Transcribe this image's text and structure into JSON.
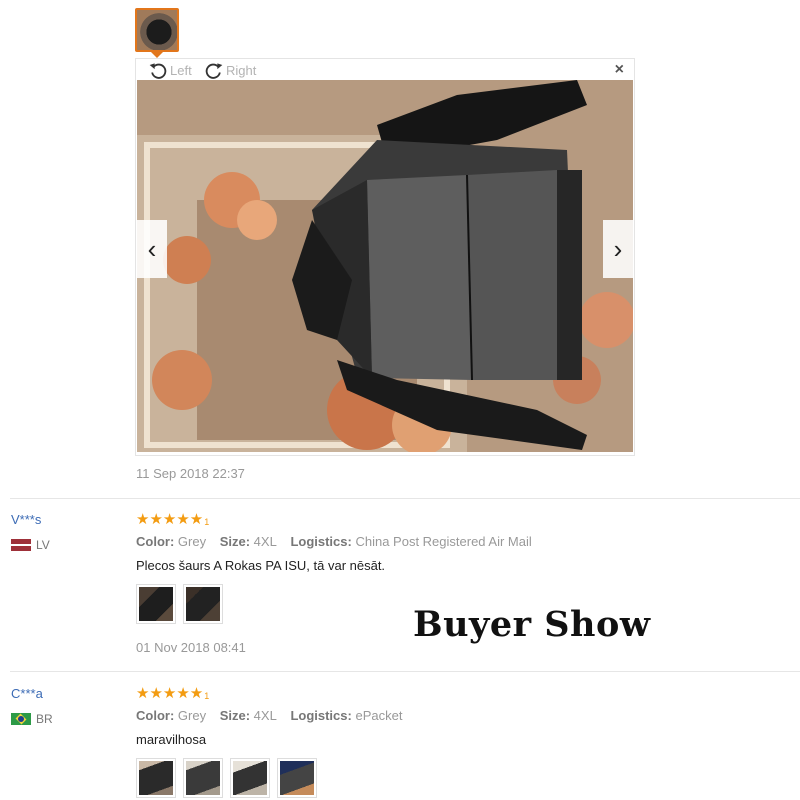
{
  "viewer": {
    "rotate_left_label": "Left",
    "rotate_right_label": "Right",
    "close_glyph": "×",
    "prev_glyph": "‹",
    "next_glyph": "›",
    "photo_date": "11 Sep 2018 22:37"
  },
  "reviews": [
    {
      "user": "V***s",
      "country": "LV",
      "stars": "★★★★★",
      "star_tail": "1",
      "color_label": "Color:",
      "color": "Grey",
      "size_label": "Size:",
      "size": "4XL",
      "logistics_label": "Logistics:",
      "logistics": "China Post Registered Air Mail",
      "comment": "Plecos šaurs A Rokas PA ISU, tā var nēsāt.",
      "date": "01 Nov 2018 08:41"
    },
    {
      "user": "C***a",
      "country": "BR",
      "stars": "★★★★★",
      "star_tail": "1",
      "color_label": "Color:",
      "color": "Grey",
      "size_label": "Size:",
      "size": "4XL",
      "logistics_label": "Logistics:",
      "logistics": "ePacket",
      "comment": "maravilhosa"
    }
  ],
  "watermark": "Buyer Show",
  "icons": {
    "rotate_left": "rotate-left-icon",
    "rotate_right": "rotate-right-icon",
    "close": "close-icon"
  },
  "colors": {
    "star": "#f39c12",
    "user_link": "#3c6bb5",
    "active_thumb_border": "#e2761b"
  }
}
